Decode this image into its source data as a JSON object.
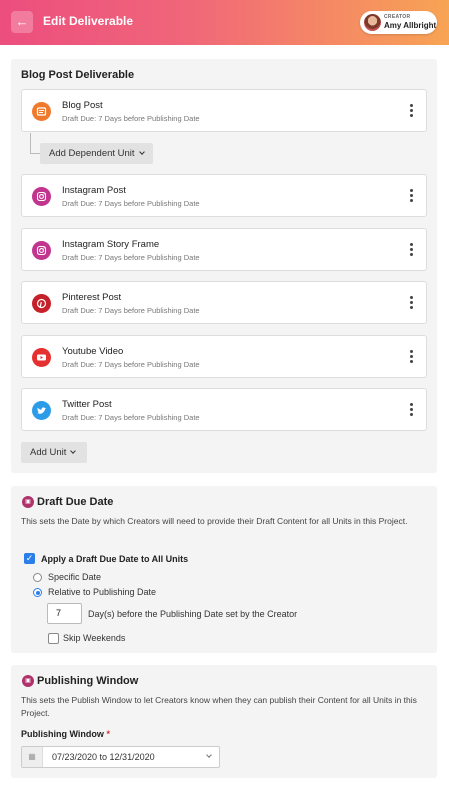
{
  "header": {
    "back_icon": "←",
    "title": "Edit Deliverable",
    "creator_label": "CREATOR",
    "creator_name": "Amy Allbright"
  },
  "deliverable": {
    "title": "Blog Post Deliverable",
    "primary_unit": {
      "name": "Blog Post",
      "sub": "Draft Due: 7 Days before Publishing Date",
      "icon": "document-icon",
      "color": "#f07a2c"
    },
    "add_dependent_label": "Add Dependent Unit",
    "units": [
      {
        "name": "Instagram Post",
        "sub": "Draft Due: 7 Days before Publishing Date",
        "icon": "instagram-icon",
        "color": "#c1358e"
      },
      {
        "name": "Instagram Story Frame",
        "sub": "Draft Due: 7 Days before Publishing Date",
        "icon": "instagram-icon",
        "color": "#c1358e"
      },
      {
        "name": "Pinterest Post",
        "sub": "Draft Due: 7 Days before Publishing Date",
        "icon": "pinterest-icon",
        "color": "#c6202a"
      },
      {
        "name": "Youtube Video",
        "sub": "Draft Due: 7 Days before Publishing Date",
        "icon": "youtube-icon",
        "color": "#e62f2f"
      },
      {
        "name": "Twitter Post",
        "sub": "Draft Due: 7 Days before Publishing Date",
        "icon": "twitter-icon",
        "color": "#2d9ce8"
      }
    ],
    "add_unit_label": "Add Unit"
  },
  "draft_due": {
    "title": "Draft Due Date",
    "description": "This sets the Date by which Creators will need to provide their Draft Content for all Units in this Project.",
    "apply_all_label": "Apply a Draft Due Date to All Units",
    "specific_date_label": "Specific Date",
    "relative_label": "Relative to Publishing Date",
    "days_value": "7",
    "days_suffix": "Day(s) before the Publishing Date set by the Creator",
    "skip_weekends_label": "Skip Weekends",
    "apply_all_checked": true,
    "relative_selected": true,
    "skip_weekends_checked": false
  },
  "publishing": {
    "title": "Publishing Window",
    "description": "This sets the Publish Window to let Creators know when they can publish their Content for all Units in this Project.",
    "field_label": "Publishing Window",
    "required_mark": "*",
    "value": "07/23/2020 to 12/31/2020"
  }
}
